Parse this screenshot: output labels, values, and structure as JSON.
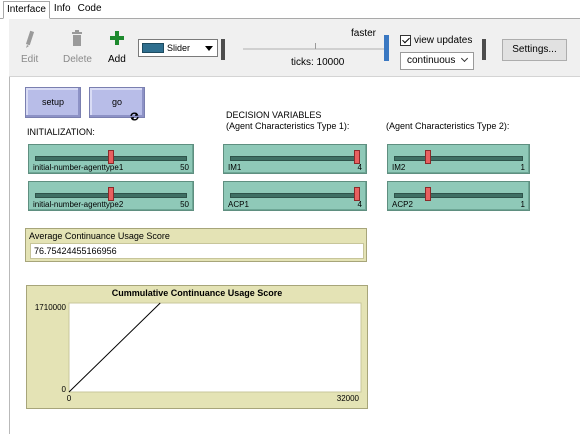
{
  "tabs": [
    {
      "label": "Interface",
      "active": true
    },
    {
      "label": "Info",
      "active": false
    },
    {
      "label": "Code",
      "active": false
    }
  ],
  "toolbar": {
    "edit_label": "Edit",
    "delete_label": "Delete",
    "add_label": "Add",
    "widget_type": "Slider",
    "speed_label": "faster",
    "ticks_text": "ticks: 10000",
    "view_updates_label": "view updates",
    "view_updates_checked": true,
    "update_mode": "continuous",
    "settings_label": "Settings..."
  },
  "buttons": {
    "setup_label": "setup",
    "go_label": "go",
    "go_forever": true
  },
  "labels": {
    "initialization": "INITIALIZATION:",
    "decision_heading": "DECISION VARIABLES\n(Agent Characteristics Type 1):",
    "type2_heading": "(Agent Characteristics Type 2):"
  },
  "sliders": [
    {
      "name": "initial-number-agenttype1",
      "value": "50",
      "fraction": 0.5,
      "color": "#8fc9b8"
    },
    {
      "name": "initial-number-agenttype2",
      "value": "50",
      "fraction": 0.5,
      "color": "#8fc9b8"
    },
    {
      "name": "IM1",
      "value": "4",
      "fraction": 1.0,
      "color": "#8fc9b8"
    },
    {
      "name": "ACP1",
      "value": "4",
      "fraction": 1.0,
      "color": "#8fc9b8"
    },
    {
      "name": "IM2",
      "value": "1",
      "fraction": 0.25,
      "color": "#8fc9b8"
    },
    {
      "name": "ACP2",
      "value": "1",
      "fraction": 0.25,
      "color": "#8fc9b8"
    }
  ],
  "monitor": {
    "label": "Average Continuance Usage Score",
    "value": "76.75424455166956"
  },
  "plot": {
    "title": "Cummulative Continuance Usage Score"
  },
  "chart_data": {
    "type": "line",
    "title": "Cummulative Continuance Usage Score",
    "xlabel": "",
    "ylabel": "",
    "xlim": [
      0,
      32000
    ],
    "ylim": [
      0,
      1710000
    ],
    "x_tick_labels": [
      "0",
      "32000"
    ],
    "y_tick_labels": [
      "0",
      "1710000"
    ],
    "series": [
      {
        "color": "#000000",
        "x": [
          0,
          10000
        ],
        "y": [
          0,
          1710000
        ]
      }
    ]
  },
  "colors": {
    "button": "#b8bde8",
    "slider": "#8fc9b8",
    "monitor": "#e4e3b5",
    "speed_knob": "#3a78c2"
  }
}
